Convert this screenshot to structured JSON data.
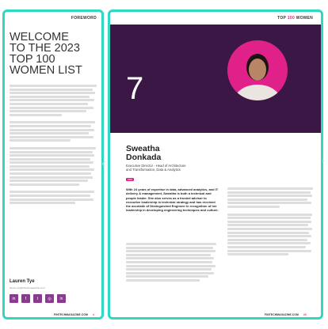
{
  "left": {
    "header": "FOREWORD",
    "title_line1": "WELCOME",
    "title_line2": "TO THE 2023",
    "title_line3": "TOP 100",
    "title_line4": "WOMEN LIST",
    "author_name": "Lauren Tye",
    "author_email": "lauren.tye@fintechmagazine.com",
    "footer": "FINTECHMAGAZINE.COM",
    "page_number": "4",
    "social_icons": [
      "in",
      "f",
      "tw",
      "ig",
      "in"
    ]
  },
  "right": {
    "header_prefix": "TOP",
    "header_accent": "100",
    "header_suffix": "WOMEN",
    "rank": "7",
    "name_line1": "Sweatha",
    "name_line2": "Donkada",
    "role_line1": "Executive Director - Head of Architecture",
    "role_line2": "and Transformation, Data & Analytics",
    "company_pill": "UBS",
    "intro": "With 24 years of expertise in data, advanced analytics, and IT delivery & management, Sweatha is both a technical and people leader. She also serves as a trusted advisor to executive leadership in technical strategy and has received the accolade of Distinguished Engineer in recognition of her leadership in developing engineering techniques and culture.",
    "footer": "FINTECHMAGAZINE.COM",
    "page_number": "23"
  },
  "colors": {
    "accent": "#e0218a",
    "teal": "#2fd8c0",
    "purple": "#3b1746"
  }
}
